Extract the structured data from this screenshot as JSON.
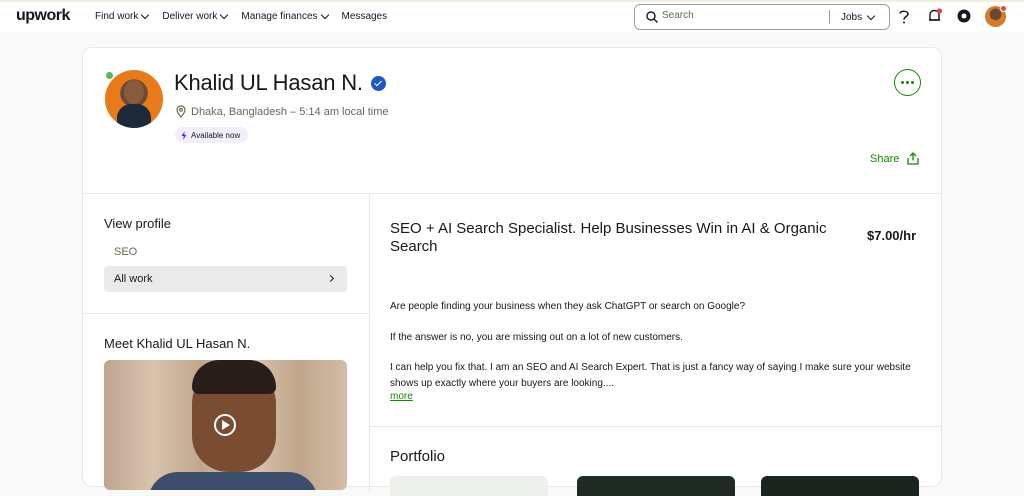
{
  "header": {
    "logo": "upwork",
    "nav": [
      {
        "label": "Find work",
        "has_dropdown": true
      },
      {
        "label": "Deliver work",
        "has_dropdown": true
      },
      {
        "label": "Manage finances",
        "has_dropdown": true
      },
      {
        "label": "Messages",
        "has_dropdown": false
      }
    ],
    "search": {
      "placeholder": "Search",
      "scope": "Jobs"
    },
    "icons": [
      "help-icon",
      "notifications-icon",
      "settings-icon",
      "user-avatar"
    ]
  },
  "profile": {
    "name": "Khalid UL Hasan N.",
    "location": "Dhaka, Bangladesh – 5:14 am local time",
    "availability": "Available now",
    "share_label": "Share"
  },
  "sidebar": {
    "view_profile_title": "View profile",
    "items": [
      "SEO",
      "All work"
    ],
    "meet_title": "Meet Khalid UL Hasan N."
  },
  "main": {
    "headline": "SEO + AI Search Specialist. Help Businesses Win in AI & Organic Search",
    "rate": "$7.00/hr",
    "description": [
      "Are people finding your business when they ask ChatGPT or search on Google?",
      "If the answer is no, you are missing out on a lot of new customers.",
      "I can help you fix that. I am an SEO and AI Search Expert. That is just a fancy way of saying I make sure your website shows up exactly where your buyers are looking...."
    ],
    "more_link": "more",
    "portfolio_title": "Portfolio"
  },
  "colors": {
    "brand_green": "#108a00",
    "verified_blue": "#1f57c3",
    "badge_purple_bg": "#f3eefe"
  }
}
